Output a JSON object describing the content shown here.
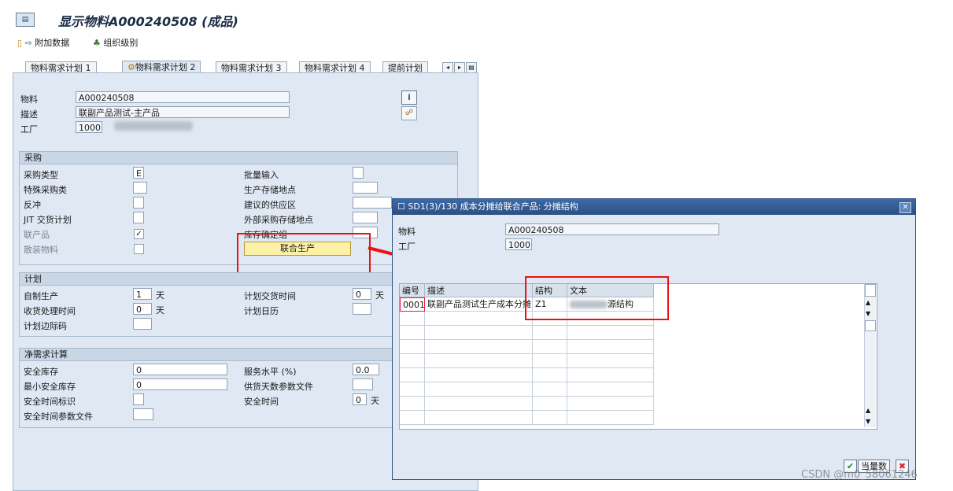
{
  "window": {
    "title": "显示物料A000240508 (成品)"
  },
  "toolbar": {
    "additional_data": "附加数据",
    "org_levels": "组织级别"
  },
  "tabs": [
    {
      "label": "物料需求计划 1"
    },
    {
      "label": "物料需求计划 2",
      "active": true
    },
    {
      "label": "物料需求计划 3"
    },
    {
      "label": "物料需求计划 4"
    },
    {
      "label": "提前计划"
    }
  ],
  "header": {
    "material_label": "物料",
    "material_value": "A000240508",
    "desc_label": "描述",
    "desc_value": "联副产品测试-主产品",
    "plant_label": "工厂",
    "plant_value": "1000"
  },
  "procurement": {
    "title": "采购",
    "proc_type_label": "采购类型",
    "proc_type_value": "E",
    "special_proc_label": "特殊采购类",
    "backflush_label": "反冲",
    "jit_label": "JIT 交货计划",
    "coproduct_label": "联产品",
    "bulk_label": "散装物料",
    "batch_entry_label": "批量输入",
    "prod_storage_label": "生产存储地点",
    "supply_area_label": "建议的供应区",
    "ext_storage_label": "外部采购存储地点",
    "stock_group_label": "库存确定组",
    "joint_prod_button": "联合生产"
  },
  "scheduling": {
    "title": "计划",
    "inhouse_label": "自制生产",
    "inhouse_value": "1",
    "inhouse_unit": "天",
    "gr_time_label": "收货处理时间",
    "gr_time_value": "0",
    "gr_time_unit": "天",
    "margin_label": "计划边际码",
    "plan_del_label": "计划交货时间",
    "plan_del_value": "0",
    "plan_del_unit": "天",
    "calendar_label": "计划日历"
  },
  "net_req": {
    "title": "净需求计算",
    "safety_stock_label": "安全库存",
    "safety_stock_value": "0",
    "min_safety_label": "最小安全库存",
    "min_safety_value": "0",
    "safety_time_ind_label": "安全时间标识",
    "safety_time_prof_label": "安全时间参数文件",
    "service_level_label": "服务水平 (%)",
    "service_level_value": "0.0",
    "coverage_prof_label": "供货天数参数文件",
    "safety_time_label": "安全时间",
    "safety_time_value": "0",
    "safety_time_unit": "天"
  },
  "dialog": {
    "title": "SD1(3)/130 成本分摊给联合产品: 分摊结构",
    "material_label": "物料",
    "material_value": "A000240508",
    "plant_label": "工厂",
    "plant_value": "1000",
    "columns": [
      "编号",
      "描述",
      "结构",
      "文本"
    ],
    "rows": [
      {
        "no": "0001",
        "desc": "联副产品测试生产成本分摊",
        "struct": "Z1",
        "text_suffix": "源结构"
      }
    ],
    "ok_button": "当量数"
  },
  "watermark": "CSDN @m0_58061246",
  "colors": {
    "highlight": "#e11111",
    "dialog_title": "#2a4f83",
    "button": "#fdf1a8"
  }
}
